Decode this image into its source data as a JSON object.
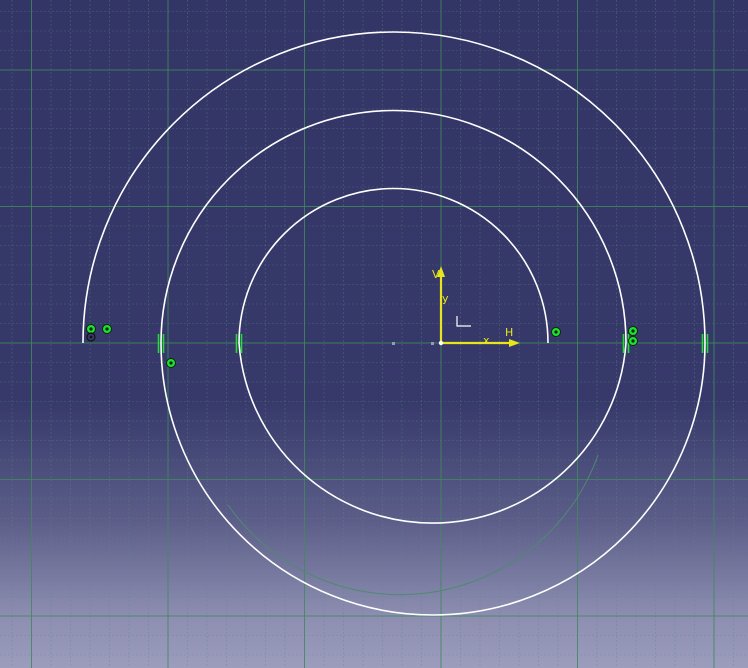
{
  "app": {
    "view": "sketcher-2d-viewport"
  },
  "colors": {
    "background_top": "#333566",
    "background_bottom": "#9c9dbd",
    "grid_minor": "#5a8a82",
    "grid_major": "#3f8a5c",
    "geometry": "#ffffff",
    "axis": "#e6e61a",
    "constraint": "#22dd33"
  },
  "axes": {
    "h_label": "H",
    "v_label": "V",
    "x_label": "x",
    "y_label": "y"
  },
  "sketch": {
    "elements": [
      "spiral-arc-outer",
      "spiral-arc-middle",
      "spiral-arc-inner",
      "construction-arc"
    ],
    "icons": [
      "origin-axis-icon",
      "coincidence-constraint-icon",
      "tangency-constraint-icon"
    ]
  }
}
